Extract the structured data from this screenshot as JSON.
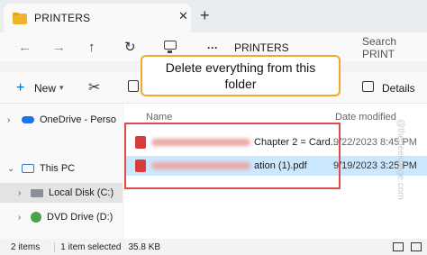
{
  "tab": {
    "title": "PRINTERS",
    "close": "✕",
    "add": "+"
  },
  "nav": {
    "back": "←",
    "forward": "→",
    "up": "↑",
    "refresh": "↻",
    "ellipsis": "···",
    "path": "PRINTERS",
    "search_placeholder": "Search PRINT"
  },
  "command": {
    "new_label": "New",
    "details_label": "Details"
  },
  "sidebar": {
    "items": [
      {
        "label": "OneDrive - Perso"
      },
      {
        "label": "This PC"
      },
      {
        "label": "Local Disk (C:)"
      },
      {
        "label": "DVD Drive (D:)"
      }
    ]
  },
  "files": {
    "headers": {
      "name": "Name",
      "date": "Date modified"
    },
    "rows": [
      {
        "name_visible": "Chapter 2 = Card...",
        "date": "9/22/2023 8:45 PM"
      },
      {
        "name_visible": "ation (1).pdf",
        "date": "9/19/2023 3:25 PM"
      }
    ]
  },
  "status": {
    "items": "2 items",
    "selected": "1 item selected",
    "size": "35.8 KB"
  },
  "callout": {
    "line1": "Delete everything from this",
    "line2": "folder"
  },
  "watermark": "@thegeekpage.com",
  "colors": {
    "callout_border": "#f0a92b",
    "highlight_box": "#e04a4a",
    "selected_row": "#cce8ff"
  }
}
